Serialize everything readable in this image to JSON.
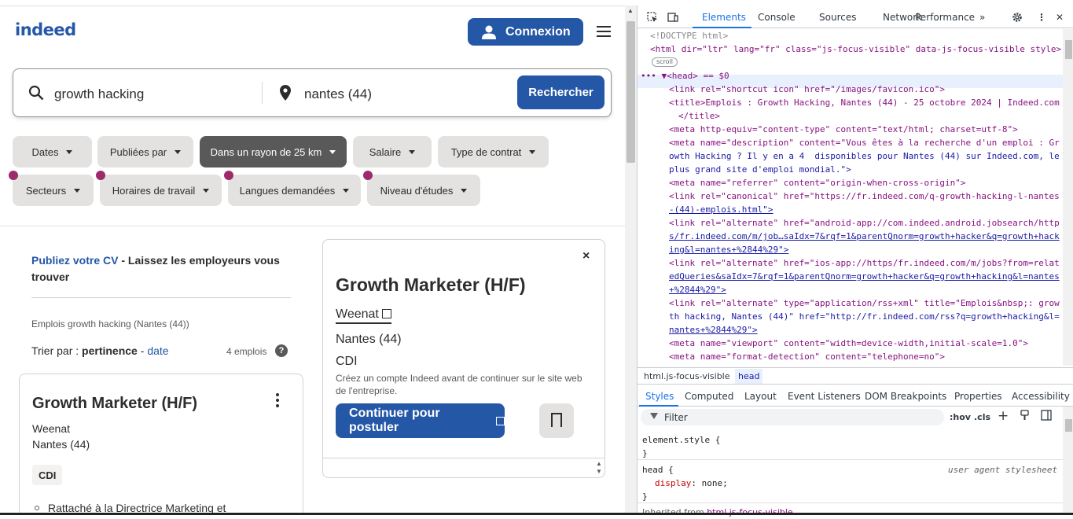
{
  "header": {
    "logo": "indeed",
    "login_label": "Connexion"
  },
  "search": {
    "what_value": "growth hacking",
    "where_value": "nantes (44)",
    "button_label": "Rechercher"
  },
  "filters": [
    {
      "label": "Dates"
    },
    {
      "label": "Publiées par"
    },
    {
      "label": "Dans un rayon de 25 km"
    },
    {
      "label": "Salaire"
    },
    {
      "label": "Type de contrat"
    },
    {
      "label": "Secteurs"
    },
    {
      "label": "Horaires de travail"
    },
    {
      "label": "Langues demandées"
    },
    {
      "label": "Niveau d'études"
    }
  ],
  "cv_banner": {
    "link": "Publiez votre CV",
    "text": " - Laissez les employeurs vous trouver"
  },
  "results": {
    "breadcrumb": "Emplois growth hacking (Nantes (44))",
    "sort_prefix": "Trier par : ",
    "sort_active": "pertinence",
    "sort_sep": " - ",
    "sort_other": "date",
    "count": "4 emplois",
    "help": "?"
  },
  "job_card": {
    "title": "Growth Marketer (H/F)",
    "company": "Weenat",
    "location": "Nantes (44)",
    "type": "CDI",
    "bullet": "Rattaché à la Directrice Marketing et"
  },
  "job_detail": {
    "close": "×",
    "title": "Growth Marketer (H/F)",
    "company": "Weenat",
    "location": "Nantes (44)",
    "type": "CDI",
    "note": "Créez un compte Indeed avant de continuer sur le site web de l'entreprise.",
    "apply_label": "Continuer pour postuler"
  },
  "devtools": {
    "tabs": [
      "Elements",
      "Console",
      "Sources",
      "Network",
      "Performance",
      "»"
    ],
    "code_lines": [
      "<!DOCTYPE html>",
      "<html dir=\"ltr\" lang=\"fr\" class=\"js-focus-visible\" data-js-focus-visible style>",
      "scroll",
      "••• ▼<head> == $0",
      "<link rel=\"shortcut icon\" href=\"/images/favicon.ico\">",
      "<title>Emplois : Growth Hacking, Nantes (44) - 25 octobre 2024 | Indeed.com",
      "</title>",
      "<meta http-equiv=\"content-type\" content=\"text/html; charset=utf-8\">",
      "<meta name=\"description\" content=\"Vous êtes à la recherche d'un emploi : Gr",
      "owth Hacking ? Il y en a 4  disponibles pour Nantes (44) sur Indeed.com, le",
      "plus grand site d'emploi mondial.\">",
      "<meta name=\"referrer\" content=\"origin-when-cross-origin\">",
      "<link rel=\"canonical\" href=\"https://fr.indeed.com/q-growth-hacking-l-nantes",
      "-(44)-emplois.html\">",
      "<link rel=\"alternate\" href=\"android-app://com.indeed.android.jobsearch/http",
      "s/fr.indeed.com/m/job…saIdx=7&rqf=1&parentQnorm=growth+hacker&q=growth+hack",
      "ing&l=nantes+%2844%29\">",
      "<link rel=\"alternate\" href=\"ios-app://https/fr.indeed.com/m/jobs?from=relat",
      "edQueries&saIdx=7&rqf=1&parentQnorm=growth+hacker&q=growth+hacking&l=nantes",
      "+%2844%29\">",
      "<link rel=\"alternate\" type=\"application/rss+xml\" title=\"Emplois&nbsp;: grow",
      "th hacking, Nantes (44)\" href=\"http://fr.indeed.com/rss?q=growth+hacking&l=",
      "nantes+%2844%29\">",
      "<meta name=\"viewport\" content=\"width=device-width,initial-scale=1.0\">",
      "<meta name=\"format-detection\" content=\"telephone=no\">"
    ],
    "breadcrumb": [
      "html.js-focus-visible",
      "head"
    ],
    "sub_tabs": [
      "Styles",
      "Computed",
      "Layout",
      "Event Listeners",
      "DOM Breakpoints",
      "Properties",
      "Accessibility"
    ],
    "filter_placeholder": "Filter",
    "hov": ":hov",
    "cls": ".cls",
    "plus": "+",
    "styles": {
      "l1": "element.style {",
      "l2": "}",
      "l3": "head {",
      "ua": "user agent stylesheet",
      "l4_prop": "display",
      "l4_val": ": none;",
      "l5": "}",
      "inherited_label": "Inherited from ",
      "inherited_val": "html.js-focus-visible"
    }
  },
  "colors": {
    "brand": "#2557a7",
    "active_chip": "#595959",
    "dot": "#9d2b6b"
  }
}
